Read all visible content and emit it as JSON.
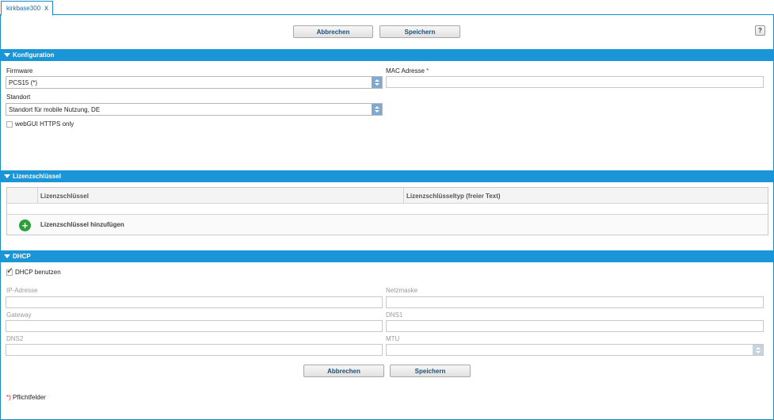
{
  "tab": {
    "title": "kirkbase300",
    "close": "x"
  },
  "toolbar": {
    "cancel_label": "Abbrechen",
    "save_label": "Speichern",
    "help_label": "?"
  },
  "konfiguration": {
    "header": "Konfiguration",
    "firmware_label": "Firmware",
    "firmware_value": "PCS15 (*)",
    "mac_label": "MAC Adresse",
    "mac_required": "*",
    "mac_value": "",
    "standort_label": "Standort",
    "standort_value": "Standort für mobile Nutzung, DE",
    "https_label": "webGUI HTTPS only"
  },
  "lizenz": {
    "header": "Lizenzschlüssel",
    "columns": [
      "Lizenzschlüssel",
      "Lizenzschlüsseltyp (freier Text)"
    ],
    "add_label": "Lizenzschlüssel hinzufügen",
    "add_icon": "+"
  },
  "dhcp": {
    "header": "DHCP",
    "use_dhcp_label": "DHCP benutzen",
    "use_dhcp_check": "✓",
    "ip_label": "IP-Adresse",
    "netmask_label": "Netzmaske",
    "gateway_label": "Gateway",
    "dns1_label": "DNS1",
    "dns2_label": "DNS2",
    "mtu_label": "MTU"
  },
  "bottom": {
    "cancel_label": "Abbrechen",
    "save_label": "Speichern"
  },
  "footer": {
    "required_marker": "*)",
    "required_text": " Pflichtfelder"
  },
  "colors": {
    "accent": "#1a96d8",
    "add_green": "#2e9e3a",
    "required": "#e02020"
  }
}
